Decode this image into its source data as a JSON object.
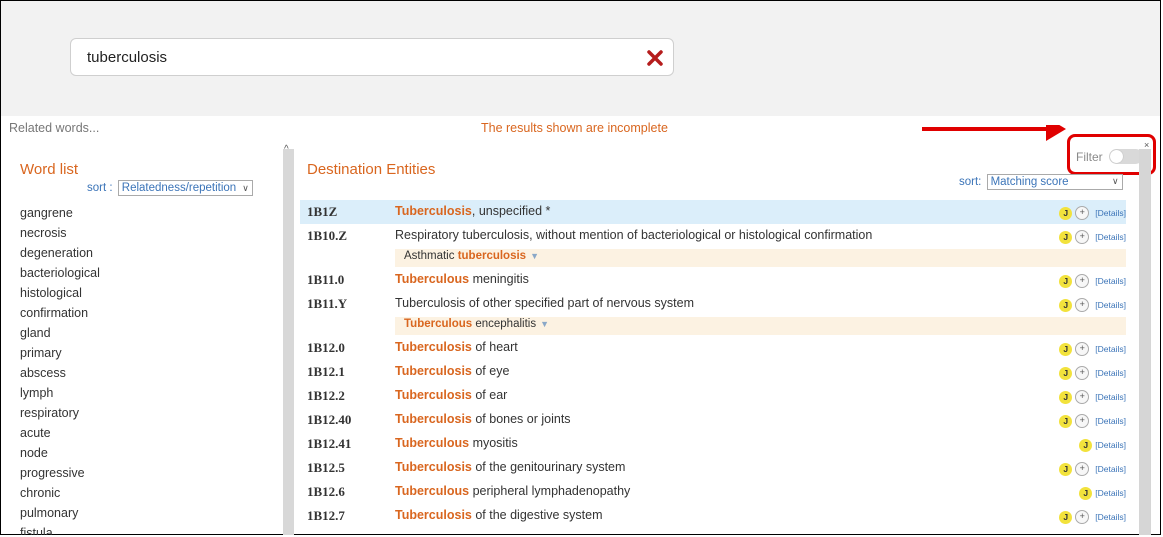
{
  "search": {
    "value": "tuberculosis"
  },
  "header": {
    "related_words_label": "Related words...",
    "incomplete_notice": "The results shown are incomplete",
    "filter_label": "Filter"
  },
  "word_list": {
    "title": "Word list",
    "sort_label": "sort :",
    "sort_value": "Relatedness/repetition",
    "words": [
      "gangrene",
      "necrosis",
      "degeneration",
      "bacteriological",
      "histological",
      "confirmation",
      "gland",
      "primary",
      "abscess",
      "lymph",
      "respiratory",
      "acute",
      "node",
      "progressive",
      "chronic",
      "pulmonary",
      "fistula"
    ]
  },
  "destination": {
    "title": "Destination Entities",
    "sort_label": "sort:",
    "sort_value": "Matching score",
    "details_label": "[Details]",
    "j_label": "J",
    "plus_label": "+",
    "rows": [
      {
        "code": "1B1Z",
        "bold": "Tuberculosis",
        "rest": ", unspecified *",
        "highlight": true,
        "plus": true
      },
      {
        "code": "1B10.Z",
        "bold": "",
        "rest": "Respiratory tuberculosis, without mention of bacteriological or histological confirmation",
        "sub_plain": "Asthmatic ",
        "sub_bold": "tuberculosis",
        "plus": true
      },
      {
        "code": "1B11.0",
        "bold": "Tuberculous",
        "rest": " meningitis",
        "plus": true
      },
      {
        "code": "1B11.Y",
        "bold": "",
        "rest": "Tuberculosis of other specified part of nervous system",
        "sub_plain": "",
        "sub_bold": "Tuberculous",
        "sub_rest": " encephalitis",
        "plus": true
      },
      {
        "code": "1B12.0",
        "bold": "Tuberculosis",
        "rest": " of heart",
        "plus": true
      },
      {
        "code": "1B12.1",
        "bold": "Tuberculosis",
        "rest": " of eye",
        "plus": true
      },
      {
        "code": "1B12.2",
        "bold": "Tuberculosis",
        "rest": " of ear",
        "plus": true
      },
      {
        "code": "1B12.40",
        "bold": "Tuberculosis",
        "rest": " of bones or joints",
        "plus": true
      },
      {
        "code": "1B12.41",
        "bold": "Tuberculous",
        "rest": " myositis",
        "plus": false
      },
      {
        "code": "1B12.5",
        "bold": "Tuberculosis",
        "rest": " of the genitourinary system",
        "plus": true
      },
      {
        "code": "1B12.6",
        "bold": "Tuberculous",
        "rest": " peripheral lymphadenopathy",
        "plus": false
      },
      {
        "code": "1B12.7",
        "bold": "Tuberculosis",
        "rest": " of the digestive system",
        "plus": true
      }
    ]
  },
  "colors": {
    "accent": "#d9661f",
    "link": "#3b74b8",
    "highlight_row": "#dbeefa",
    "sub_row": "#fcf2e2",
    "annotation": "#e00000"
  }
}
